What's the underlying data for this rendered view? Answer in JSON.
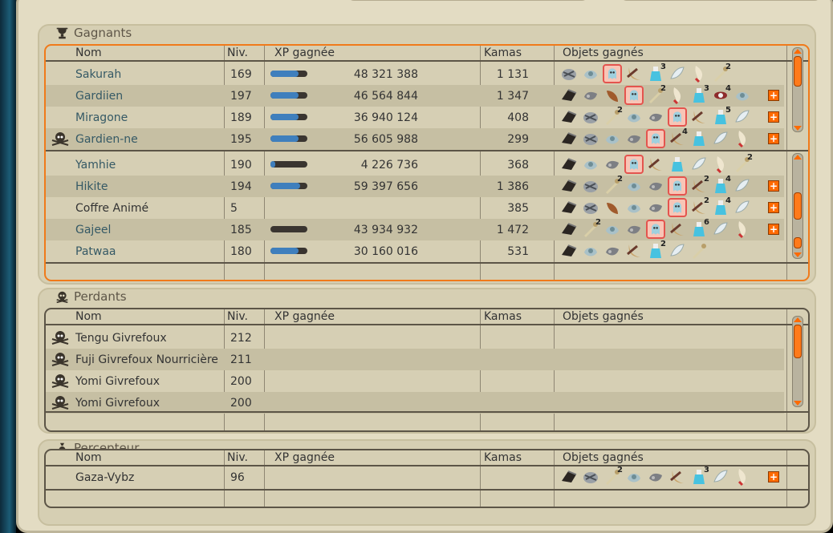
{
  "sections": {
    "winners_title": "Gagnants",
    "losers_title": "Perdants",
    "collector_title": "Percepteur"
  },
  "columns": {
    "name": "Nom",
    "level": "Niv.",
    "xp": "XP gagnée",
    "kamas": "Kamas",
    "items": "Objets gagnés"
  },
  "winners_a": [
    {
      "name": "Sakurah",
      "level": "169",
      "xp": "48 321 388",
      "kamas": "1 131",
      "xp_fill": 0.75
    },
    {
      "name": "Gardiien",
      "level": "197",
      "xp": "46 564 844",
      "kamas": "1 347",
      "xp_fill": 0.75
    },
    {
      "name": "Miragone",
      "level": "189",
      "xp": "36 940 124",
      "kamas": "408",
      "xp_fill": 0.75
    },
    {
      "name": "Gardien-ne",
      "level": "195",
      "xp": "56 605 988",
      "kamas": "299",
      "xp_fill": 0.75,
      "dead": true
    }
  ],
  "winners_b": [
    {
      "name": "Yamhie",
      "level": "190",
      "xp": "4 226 736",
      "kamas": "368",
      "xp_fill": 0.12
    },
    {
      "name": "Hikite",
      "level": "194",
      "xp": "59 397 656",
      "kamas": "1 386",
      "xp_fill": 0.8
    },
    {
      "name": "Coffre Animé",
      "level": "5",
      "xp": "",
      "kamas": "385",
      "xp_fill": null,
      "plain": true
    },
    {
      "name": "Gajeel",
      "level": "185",
      "xp": "43 934 932",
      "kamas": "1 472",
      "xp_fill": 0.0
    },
    {
      "name": "Patwaa",
      "level": "180",
      "xp": "30 160 016",
      "kamas": "531",
      "xp_fill": 0.75
    }
  ],
  "losers": [
    {
      "name": "Tengu Givrefoux",
      "level": "212"
    },
    {
      "name": "Fuji Givrefoux Nourricière",
      "level": "211"
    },
    {
      "name": "Yomi Givrefoux",
      "level": "200"
    },
    {
      "name": "Yomi Givrefoux",
      "level": "200"
    }
  ],
  "collector": [
    {
      "name": "Gaza-Vybz",
      "level": "96"
    }
  ],
  "item_quantities": {
    "row1": [
      "",
      "",
      "",
      "",
      "3",
      "",
      "",
      "2"
    ],
    "row2": [
      "",
      "",
      "",
      "",
      "2",
      "",
      "3",
      "4",
      ""
    ],
    "row3": [
      "",
      "",
      "2",
      "",
      "",
      "",
      "",
      "5",
      ""
    ],
    "row4": [
      "",
      "",
      "",
      "",
      "",
      "4",
      "",
      ""
    ],
    "row5": [
      "",
      "",
      "",
      "",
      "",
      "",
      "",
      "",
      "2"
    ],
    "row6": [
      "",
      "",
      "2",
      "",
      "",
      "",
      "2",
      "4",
      ""
    ],
    "row7": [
      "",
      "",
      "",
      "",
      "",
      "",
      "2",
      "4",
      ""
    ],
    "row8": [
      "",
      "2",
      "",
      "",
      "",
      "",
      "6",
      "",
      ""
    ],
    "row9": [
      "",
      "",
      "",
      "",
      "2",
      "",
      ""
    ],
    "col1": [
      "",
      "",
      "2",
      "",
      "",
      "",
      "3",
      "",
      ""
    ]
  },
  "colors": {
    "accent": "#f07a1a",
    "xp_bar": "#3f7fbd",
    "plus_button": "#ff6a00"
  }
}
